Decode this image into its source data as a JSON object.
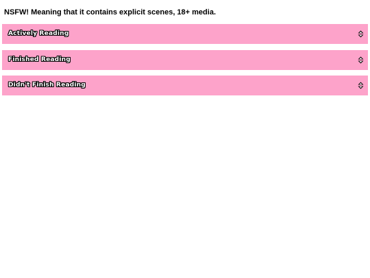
{
  "notice": {
    "text": "NSFW! Meaning that it contains explicit scenes, 18+ media."
  },
  "sections": [
    {
      "label": "Actively Reading",
      "icon": "expand-collapse-icon"
    },
    {
      "label": "Finished Reading",
      "icon": "expand-collapse-icon"
    },
    {
      "label": "Didn't Finish Reading",
      "icon": "expand-collapse-icon"
    }
  ],
  "colors": {
    "accordion_bg": "#fda3ca",
    "label_text": "#ffffff",
    "label_outline": "#000000"
  }
}
